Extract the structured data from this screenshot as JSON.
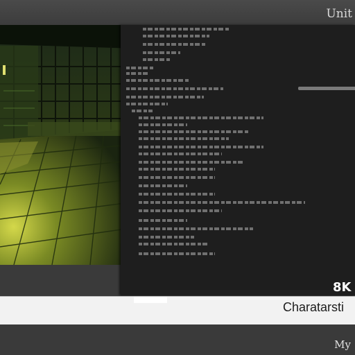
{
  "app": {
    "title": "Unit"
  },
  "viewport": {
    "label": ""
  },
  "code_panel": {
    "lines": []
  },
  "overlay": {
    "resolution": "8K",
    "caption": "Charatarsti"
  },
  "footer": {
    "text": "My"
  },
  "colors": {
    "panel": "#1e1e1e",
    "caption_bar": "#f2f2f2",
    "chrome": "#3a3a3a",
    "floor_glow": "#c8d040"
  }
}
